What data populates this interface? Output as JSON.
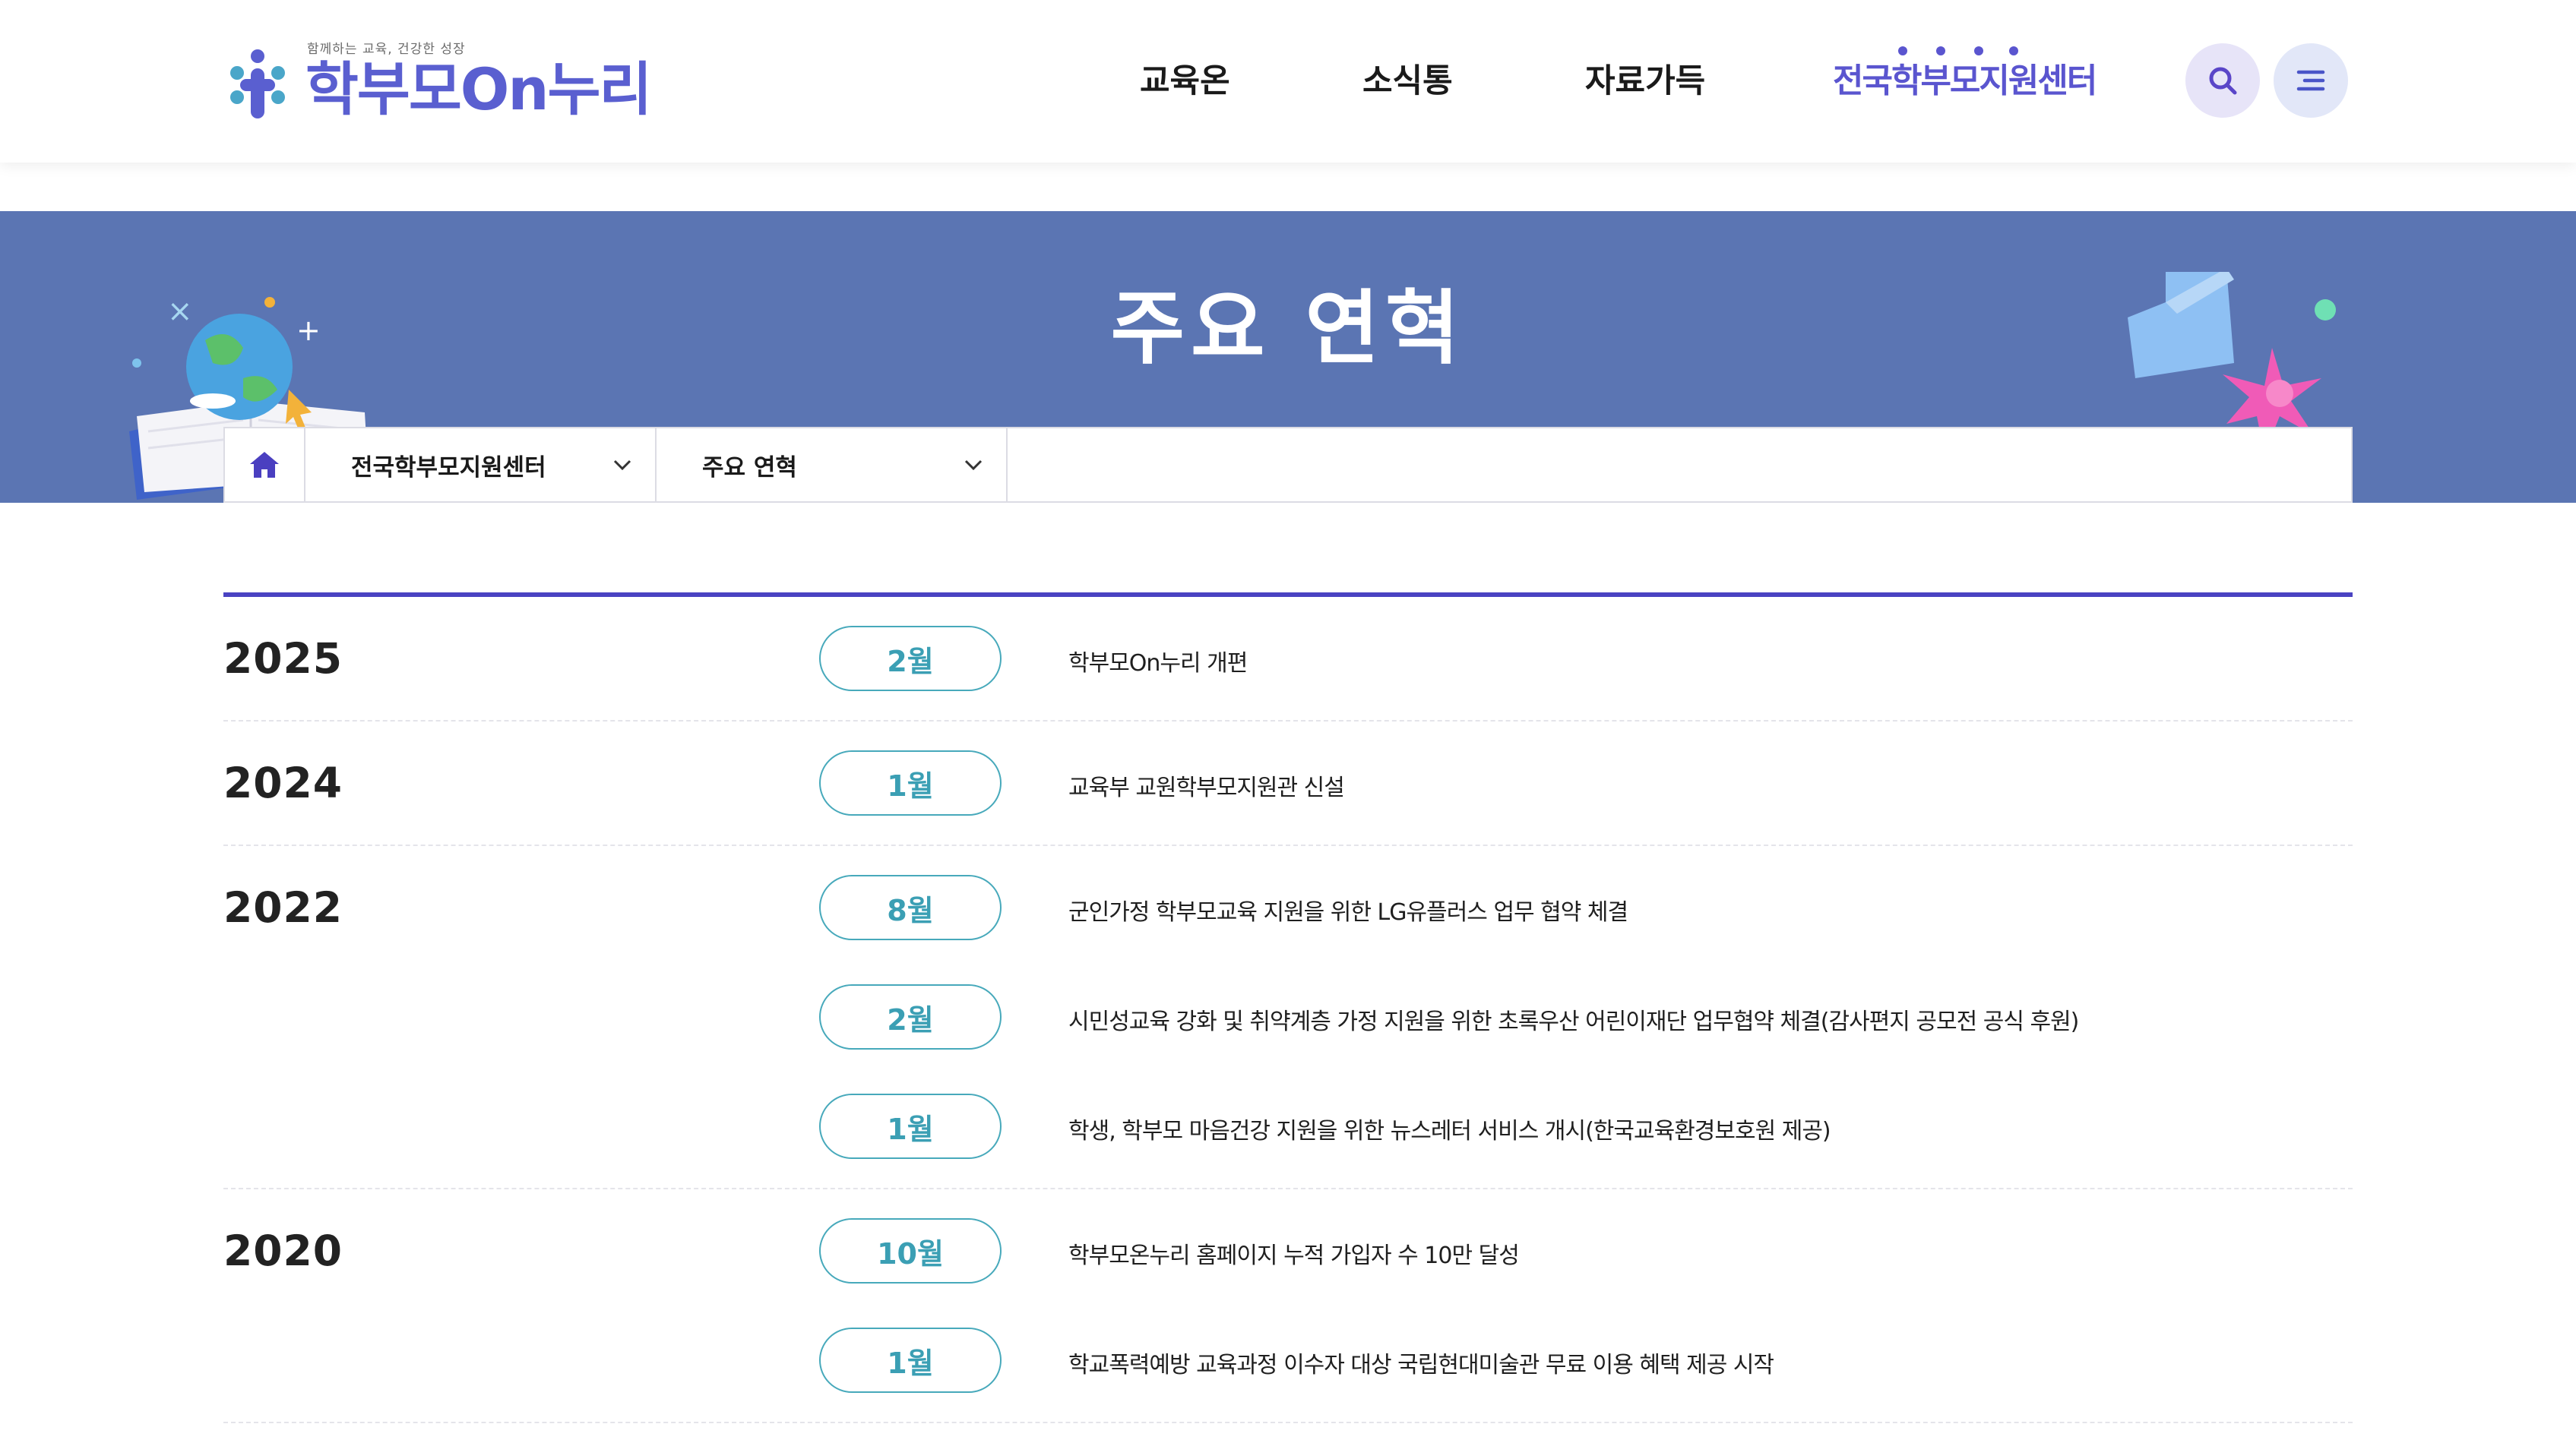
{
  "header": {
    "logo_tagline": "함께하는 교육, 건강한 성장",
    "logo_text": "학부모On누리",
    "nav": [
      "교육온",
      "소식통",
      "자료가득"
    ],
    "nav_center": "전국학부모지원센터",
    "search_icon": "search-icon",
    "menu_icon": "menu-icon"
  },
  "banner": {
    "title": "주요 연혁"
  },
  "breadcrumb": {
    "home_icon": "home-icon",
    "level1": "전국학부모지원센터",
    "level2": "주요 연혁"
  },
  "timeline": [
    {
      "year": "2025",
      "entries": [
        {
          "month": "2월",
          "text": "학부모On누리 개편"
        }
      ]
    },
    {
      "year": "2024",
      "entries": [
        {
          "month": "1월",
          "text": "교육부 교원학부모지원관 신설"
        }
      ]
    },
    {
      "year": "2022",
      "entries": [
        {
          "month": "8월",
          "text": "군인가정 학부모교육 지원을 위한 LG유플러스 업무 협약 체결"
        },
        {
          "month": "2월",
          "text": "시민성교육 강화 및 취약계층 가정 지원을 위한 초록우산 어린이재단 업무협약 체결(감사편지 공모전 공식 후원)"
        },
        {
          "month": "1월",
          "text": "학생, 학부모 마음건강 지원을 위한 뉴스레터 서비스 개시(한국교육환경보호원 제공)"
        }
      ]
    },
    {
      "year": "2020",
      "entries": [
        {
          "month": "10월",
          "text": "학부모온누리 홈페이지 누적 가입자 수 10만 달성"
        },
        {
          "month": "1월",
          "text": "학교폭력예방 교육과정 이수자 대상 국립현대미술관 무료 이용 혜택 제공 시작"
        }
      ]
    }
  ],
  "colors": {
    "banner": "#5b75b3",
    "accent": "#4a43c2",
    "pill": "#47a9bb"
  }
}
